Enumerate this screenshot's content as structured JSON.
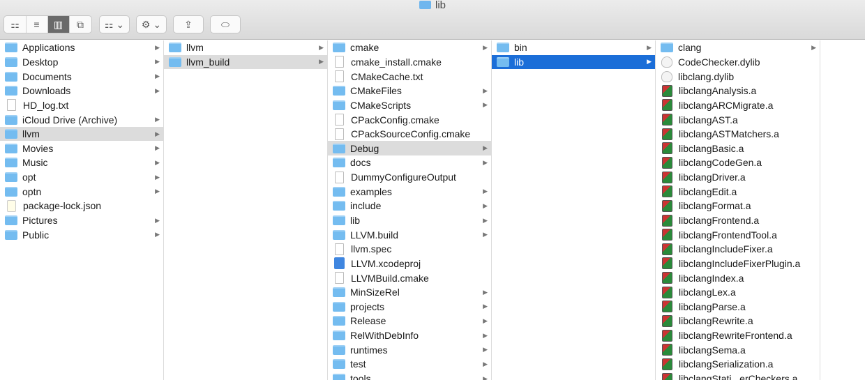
{
  "window": {
    "title": "lib"
  },
  "toolbar": {
    "view_icons": "⚏",
    "view_list": "≡",
    "view_columns": "▥",
    "view_gallery": "⧉",
    "arrange": "⚏ ⌄",
    "action": "⚙ ⌄",
    "share": "⇪",
    "tags": "⬭"
  },
  "columns": [
    {
      "items": [
        {
          "label": "Applications",
          "type": "folder",
          "arrow": true
        },
        {
          "label": "Desktop",
          "type": "folder",
          "arrow": true
        },
        {
          "label": "Documents",
          "type": "folder",
          "arrow": true
        },
        {
          "label": "Downloads",
          "type": "folder",
          "arrow": true
        },
        {
          "label": "HD_log.txt",
          "type": "file"
        },
        {
          "label": "iCloud Drive (Archive)",
          "type": "folder",
          "arrow": true
        },
        {
          "label": "llvm",
          "type": "folder",
          "arrow": true,
          "state": "sel"
        },
        {
          "label": "Movies",
          "type": "folder",
          "arrow": true
        },
        {
          "label": "Music",
          "type": "folder",
          "arrow": true
        },
        {
          "label": "opt",
          "type": "folder",
          "arrow": true
        },
        {
          "label": "optn",
          "type": "folder",
          "arrow": true
        },
        {
          "label": "package-lock.json",
          "type": "json"
        },
        {
          "label": "Pictures",
          "type": "folder",
          "arrow": true
        },
        {
          "label": "Public",
          "type": "folder",
          "arrow": true
        }
      ]
    },
    {
      "items": [
        {
          "label": "llvm",
          "type": "folder",
          "arrow": true
        },
        {
          "label": "llvm_build",
          "type": "folder",
          "arrow": true,
          "state": "sel"
        }
      ]
    },
    {
      "items": [
        {
          "label": "cmake",
          "type": "folder",
          "arrow": true
        },
        {
          "label": "cmake_install.cmake",
          "type": "file"
        },
        {
          "label": "CMakeCache.txt",
          "type": "file"
        },
        {
          "label": "CMakeFiles",
          "type": "folder",
          "arrow": true
        },
        {
          "label": "CMakeScripts",
          "type": "folder",
          "arrow": true
        },
        {
          "label": "CPackConfig.cmake",
          "type": "file"
        },
        {
          "label": "CPackSourceConfig.cmake",
          "type": "file"
        },
        {
          "label": "Debug",
          "type": "folder",
          "arrow": true,
          "state": "sel"
        },
        {
          "label": "docs",
          "type": "folder",
          "arrow": true
        },
        {
          "label": "DummyConfigureOutput",
          "type": "file"
        },
        {
          "label": "examples",
          "type": "folder",
          "arrow": true
        },
        {
          "label": "include",
          "type": "folder",
          "arrow": true
        },
        {
          "label": "lib",
          "type": "folder",
          "arrow": true
        },
        {
          "label": "LLVM.build",
          "type": "folder",
          "arrow": true
        },
        {
          "label": "llvm.spec",
          "type": "file"
        },
        {
          "label": "LLVM.xcodeproj",
          "type": "proj"
        },
        {
          "label": "LLVMBuild.cmake",
          "type": "file"
        },
        {
          "label": "MinSizeRel",
          "type": "folder",
          "arrow": true
        },
        {
          "label": "projects",
          "type": "folder",
          "arrow": true
        },
        {
          "label": "Release",
          "type": "folder",
          "arrow": true
        },
        {
          "label": "RelWithDebInfo",
          "type": "folder",
          "arrow": true
        },
        {
          "label": "runtimes",
          "type": "folder",
          "arrow": true
        },
        {
          "label": "test",
          "type": "folder",
          "arrow": true
        },
        {
          "label": "tools",
          "type": "folder",
          "arrow": true
        }
      ]
    },
    {
      "items": [
        {
          "label": "bin",
          "type": "folder",
          "arrow": true
        },
        {
          "label": "lib",
          "type": "folder",
          "arrow": true,
          "state": "act"
        }
      ]
    },
    {
      "items": [
        {
          "label": "clang",
          "type": "folder",
          "arrow": true
        },
        {
          "label": "CodeChecker.dylib",
          "type": "dylib"
        },
        {
          "label": "libclang.dylib",
          "type": "dylib"
        },
        {
          "label": "libclangAnalysis.a",
          "type": "lib"
        },
        {
          "label": "libclangARCMigrate.a",
          "type": "lib"
        },
        {
          "label": "libclangAST.a",
          "type": "lib"
        },
        {
          "label": "libclangASTMatchers.a",
          "type": "lib"
        },
        {
          "label": "libclangBasic.a",
          "type": "lib"
        },
        {
          "label": "libclangCodeGen.a",
          "type": "lib"
        },
        {
          "label": "libclangDriver.a",
          "type": "lib"
        },
        {
          "label": "libclangEdit.a",
          "type": "lib"
        },
        {
          "label": "libclangFormat.a",
          "type": "lib"
        },
        {
          "label": "libclangFrontend.a",
          "type": "lib"
        },
        {
          "label": "libclangFrontendTool.a",
          "type": "lib"
        },
        {
          "label": "libclangIncludeFixer.a",
          "type": "lib"
        },
        {
          "label": "libclangIncludeFixerPlugin.a",
          "type": "lib"
        },
        {
          "label": "libclangIndex.a",
          "type": "lib"
        },
        {
          "label": "libclangLex.a",
          "type": "lib"
        },
        {
          "label": "libclangParse.a",
          "type": "lib"
        },
        {
          "label": "libclangRewrite.a",
          "type": "lib"
        },
        {
          "label": "libclangRewriteFrontend.a",
          "type": "lib"
        },
        {
          "label": "libclangSema.a",
          "type": "lib"
        },
        {
          "label": "libclangSerialization.a",
          "type": "lib"
        },
        {
          "label": "libclangStati...erCheckers.a",
          "type": "lib"
        }
      ]
    }
  ]
}
